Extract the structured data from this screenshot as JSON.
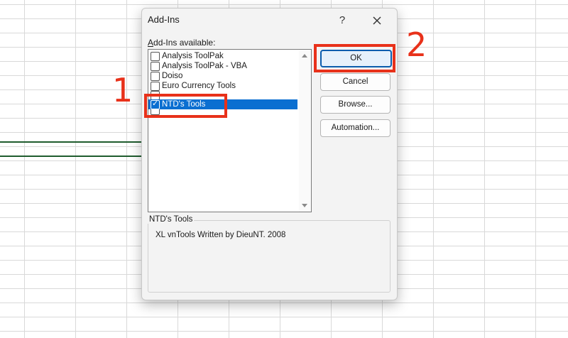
{
  "dialog": {
    "title": "Add-Ins",
    "help": "?",
    "available_label_underlined": "A",
    "available_label_rest": "dd-Ins available:"
  },
  "addins": [
    {
      "label": "Analysis ToolPak",
      "checked": false
    },
    {
      "label": "Analysis ToolPak - VBA",
      "checked": false
    },
    {
      "label": "Doiso",
      "checked": false
    },
    {
      "label": "Euro Currency Tools",
      "checked": false
    },
    {
      "label": "NTD's Tools",
      "checked": true,
      "selected": true
    }
  ],
  "buttons": {
    "ok": "OK",
    "cancel": "Cancel",
    "browse": "Browse...",
    "automation": "Automation..."
  },
  "description": {
    "title": "NTD's Tools",
    "text": "XL vnTools Written by DieuNT. 2008"
  },
  "annotations": {
    "step1": "1",
    "step2": "2",
    "color": "#e8311a"
  },
  "colors": {
    "selection": "#0b6fd1",
    "default_button_border": "#0b5cad"
  }
}
